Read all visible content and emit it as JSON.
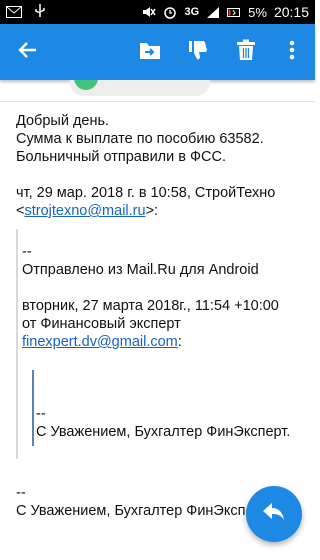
{
  "status_bar": {
    "network": "3G",
    "battery": "5%",
    "time": "20:15"
  },
  "app_bar": {
    "icons": [
      "back-arrow-icon",
      "move-to-folder-icon",
      "thumbs-down-icon",
      "delete-icon",
      "more-vert-icon"
    ],
    "accent": "#1e88e5"
  },
  "message": {
    "greeting": "Добрый день.",
    "line2": "Сумма к выплате по пособию 63582.",
    "line3": "Больничный отправили в ФСС.",
    "quote_header": "чт, 29 мар. 2018 г. в 10:58, СтройТехно",
    "quote_header_email": "strojtexno@mail.ru",
    "quote_header_open": "<",
    "quote_header_close": ">:",
    "q1_dashes": "--",
    "q1_sent_from": "Отправлено из Mail.Ru для Android",
    "q1_date": "вторник, 27 марта 2018г., 11:54 +10:00",
    "q1_from": "от Финансовый эксперт",
    "q1_email": "finexpert.dv@gmail.com",
    "q1_email_suffix": ":",
    "q2_dashes": "--",
    "q2_signature": "С Уважением, Бухгалтер ФинЭксперт.",
    "sig_dashes": "--",
    "signature": "С Уважением, Бухгалтер ФинЭксперт."
  }
}
